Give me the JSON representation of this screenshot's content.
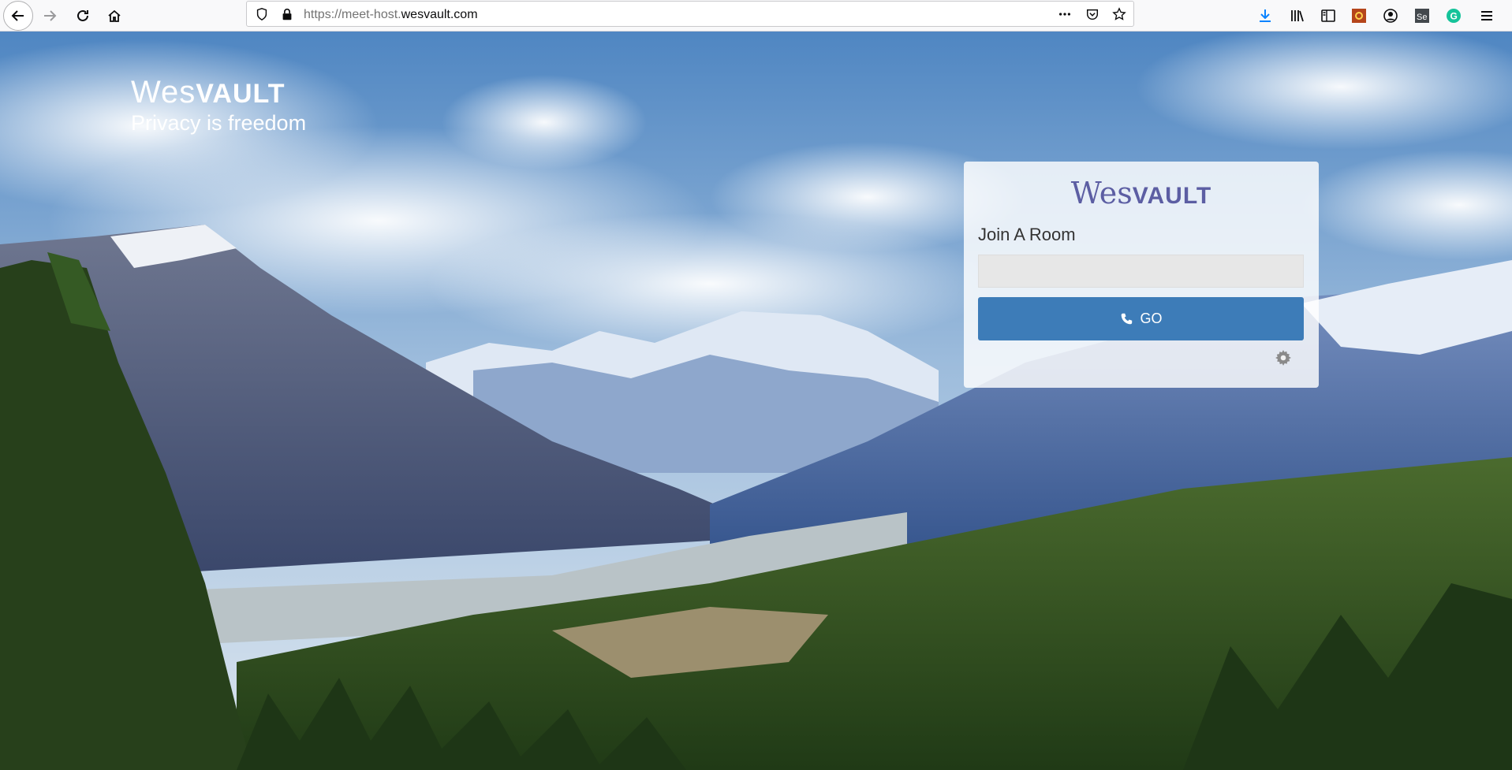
{
  "browser": {
    "url_prefix": "https://meet-host.",
    "url_domain": "wesvault.com"
  },
  "brand": {
    "name_a": "Wes",
    "name_b": "VAULT",
    "tagline": "Privacy is freedom"
  },
  "card": {
    "logo_a": "Wes",
    "logo_b": "VAULT",
    "label": "Join A Room",
    "input_value": "",
    "input_placeholder": "",
    "go_label": "GO"
  },
  "icons": [
    "back-arrow-icon",
    "forward-arrow-icon",
    "reload-icon",
    "home-icon",
    "shield-icon",
    "lock-icon",
    "more-icon",
    "pocket-icon",
    "star-icon",
    "download-icon",
    "library-icon",
    "sidebar-icon",
    "extension-icon",
    "account-icon",
    "selenium-icon",
    "grammarly-icon",
    "menu-icon",
    "phone-icon",
    "gear-icon"
  ]
}
